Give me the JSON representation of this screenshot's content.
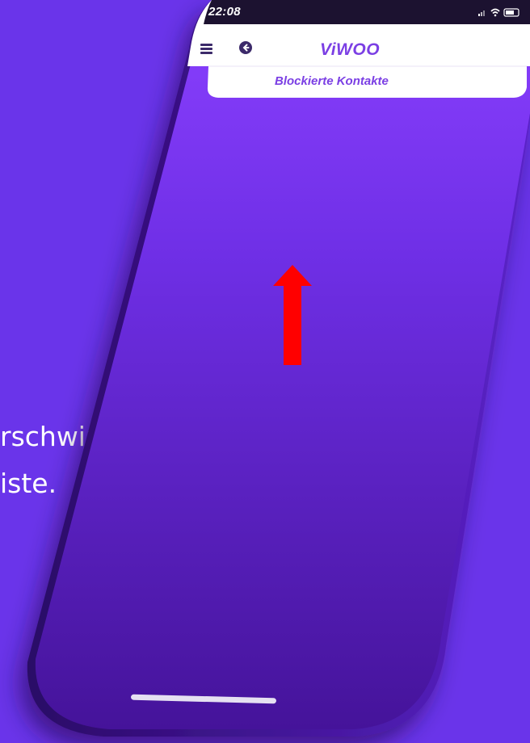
{
  "caption": {
    "line1": "rschwindet der Kontakt",
    "line2": "iste."
  },
  "status_bar": {
    "time": "22:08",
    "icons": [
      "signal-icon",
      "wifi-icon",
      "battery-icon"
    ]
  },
  "app_header": {
    "logo": "ViWOO",
    "menu_icon": "hamburger-menu-icon",
    "back_icon": "back-arrow-icon"
  },
  "subheader": {
    "title": "Blockierte Kontakte"
  },
  "annotation": {
    "arrow_direction": "up",
    "arrow_color": "#ff0000"
  },
  "colors": {
    "background": "#6a34ea",
    "screen_top": "#7f3cf5",
    "screen_bottom": "#4a159f",
    "accent": "#7b3fe4",
    "header_bg": "#ffffff"
  }
}
